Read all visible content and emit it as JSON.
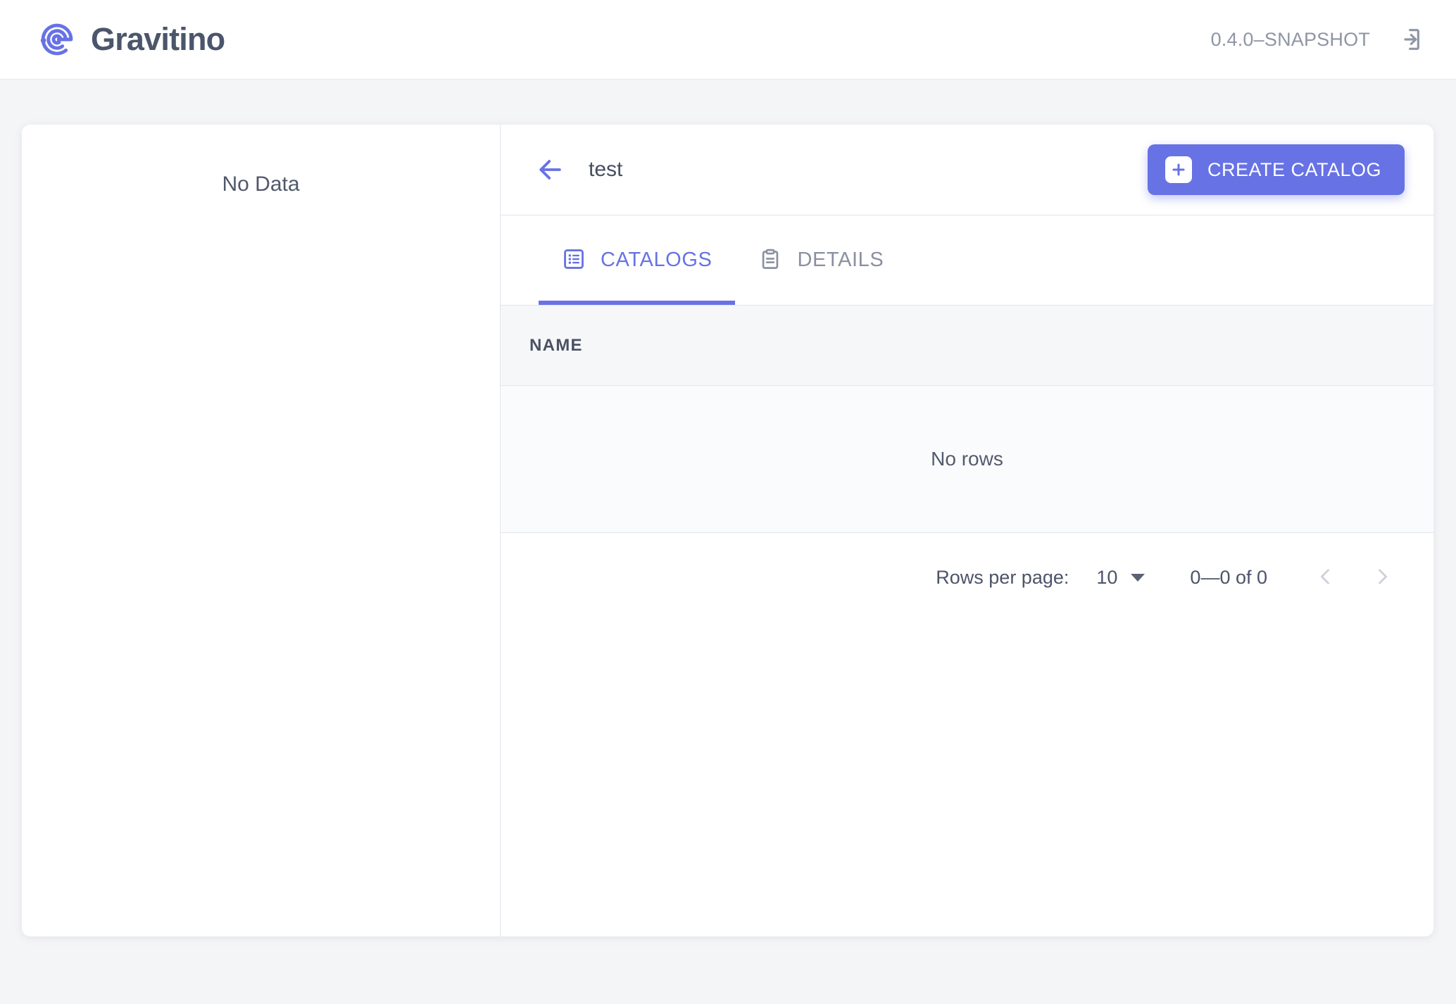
{
  "appbar": {
    "brand_name": "Gravitino",
    "logo_icon": "gravitino-spiral-logo",
    "version": "0.4.0–SNAPSHOT",
    "logout_icon": "logout-icon"
  },
  "tree_pane": {
    "empty_text": "No Data"
  },
  "content": {
    "back_icon": "arrow-left-icon",
    "breadcrumb_title": "test",
    "create_button": {
      "label": "CREATE CATALOG",
      "icon": "plus-square-icon"
    },
    "tabs": [
      {
        "label": "CATALOGS",
        "icon": "list-box-icon",
        "active": true
      },
      {
        "label": "DETAILS",
        "icon": "clipboard-icon",
        "active": false
      }
    ],
    "table": {
      "columns": [
        "NAME"
      ],
      "rows": [],
      "empty_text": "No rows"
    },
    "pagination": {
      "rows_per_page_label": "Rows per page:",
      "rows_per_page_value": "10",
      "range_label": "0—0 of 0",
      "prev_icon": "chevron-left-icon",
      "next_icon": "chevron-right-icon"
    }
  },
  "colors": {
    "accent": "#6772e5",
    "page_bg": "#f4f5f7",
    "text_dark": "#4b566b",
    "text_muted": "#8f95a5",
    "border": "#e3e5ec"
  }
}
